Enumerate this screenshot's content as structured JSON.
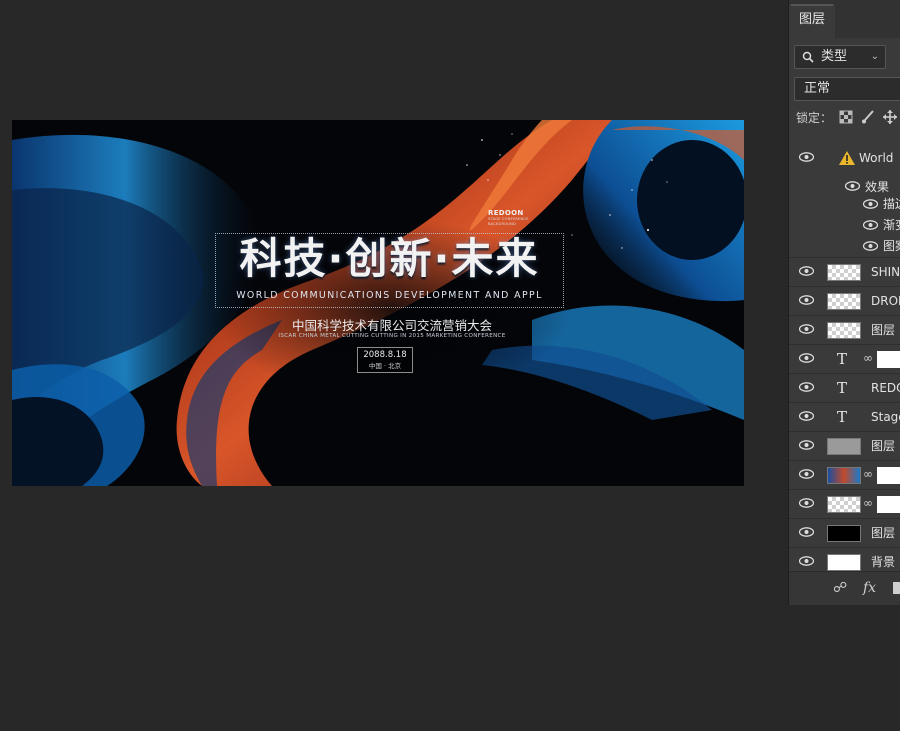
{
  "canvas": {
    "headline": "科技·创新·未来",
    "subtitle": "WORLD COMMUNICATIONS DEVELOPMENT AND APPL",
    "company_cn": "中国科学技术有限公司交流营销大会",
    "company_en": "ISCAR CHINA METAL CUTTING CUTTING IN 2015 MARKETING CONFERENCE",
    "date": "2088.8.18",
    "location": "中国 · 北京",
    "brand_title": "REDOON",
    "brand_lines": [
      "STAGE CONFERENCE",
      "BACKGROUND"
    ]
  },
  "panel": {
    "tab_label": "图层",
    "filter_label": "类型",
    "blend_mode": "正常",
    "lock_label": "锁定：",
    "layers": [
      {
        "name": "World",
        "kind": "text-warning"
      },
      {
        "name": "效果",
        "kind": "effects"
      },
      {
        "name": "描边",
        "kind": "effect"
      },
      {
        "name": "渐变",
        "kind": "effect"
      },
      {
        "name": "图案",
        "kind": "effect"
      },
      {
        "name": "SHINI",
        "kind": "pixel"
      },
      {
        "name": "DROP",
        "kind": "pixel"
      },
      {
        "name": "图层",
        "kind": "pixel"
      },
      {
        "name": "",
        "kind": "text-linked"
      },
      {
        "name": "REDO",
        "kind": "text"
      },
      {
        "name": "Stage",
        "kind": "text"
      },
      {
        "name": "图层",
        "kind": "gray"
      },
      {
        "name": "",
        "kind": "smart"
      },
      {
        "name": "",
        "kind": "smart-checker"
      },
      {
        "name": "图层",
        "kind": "black"
      },
      {
        "name": "背景",
        "kind": "white"
      }
    ]
  },
  "colors": {
    "workspace": "#282828",
    "panel": "#3a3a3a",
    "accent_orange": "#e0502a",
    "accent_blue": "#2a8fd6"
  }
}
